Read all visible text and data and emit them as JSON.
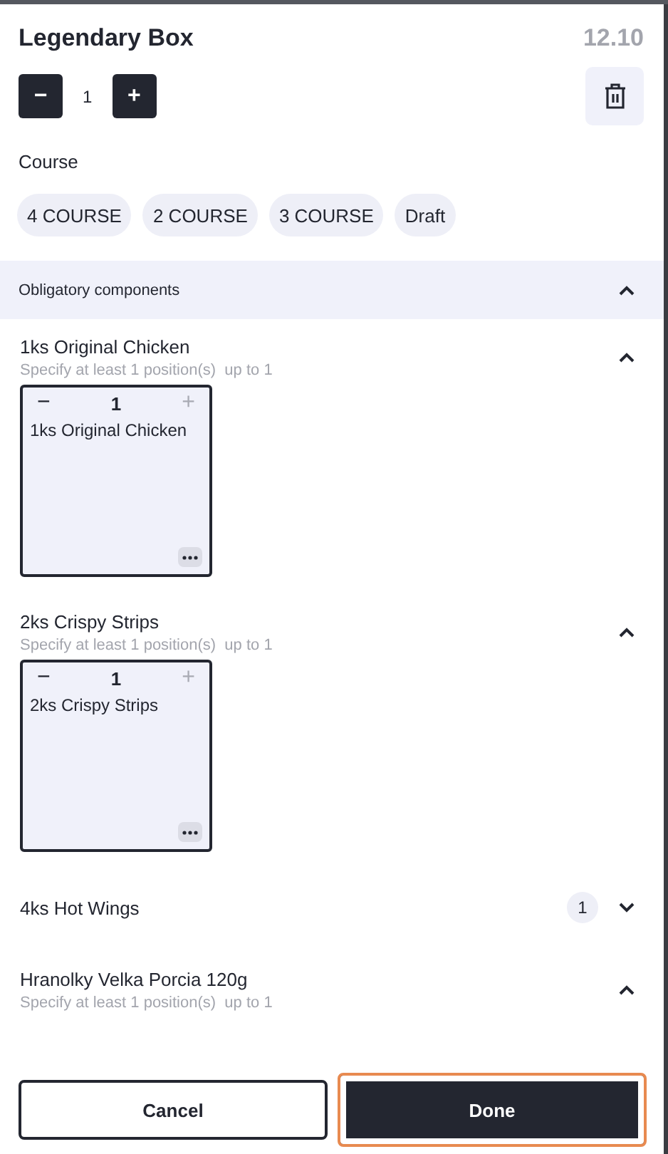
{
  "header": {
    "title": "Legendary Box",
    "price": "12.10",
    "quantity": "1",
    "minus": "−",
    "plus": "+"
  },
  "course": {
    "label": "Course",
    "chips": [
      "4 COURSE",
      "2 COURSE",
      "3 COURSE",
      "Draft"
    ]
  },
  "section": {
    "title": "Obligatory components",
    "expanded": true
  },
  "groups": [
    {
      "name": "1ks Original Chicken",
      "hint": "Specify at least 1 position(s)  up to 1",
      "expanded": true,
      "options": [
        {
          "name": "1ks Original Chicken",
          "quantity": "1",
          "minus": "−",
          "plus": "+",
          "plus_disabled": true
        }
      ]
    },
    {
      "name": "2ks Crispy Strips",
      "hint": "Specify at least 1 position(s)  up to 1",
      "expanded": true,
      "options": [
        {
          "name": "2ks Crispy Strips",
          "quantity": "1",
          "minus": "−",
          "plus": "+",
          "plus_disabled": true
        }
      ]
    },
    {
      "name": "4ks Hot Wings",
      "expanded": false,
      "count": "1"
    },
    {
      "name": "Hranolky Velka Porcia 120g",
      "hint": "Specify at least 1 position(s)  up to 1",
      "expanded": true
    }
  ],
  "footer": {
    "buttons": [
      {
        "label": "Cancel",
        "kind": "secondary",
        "focused": false
      },
      {
        "label": "Done",
        "kind": "primary",
        "focused": true
      }
    ]
  }
}
